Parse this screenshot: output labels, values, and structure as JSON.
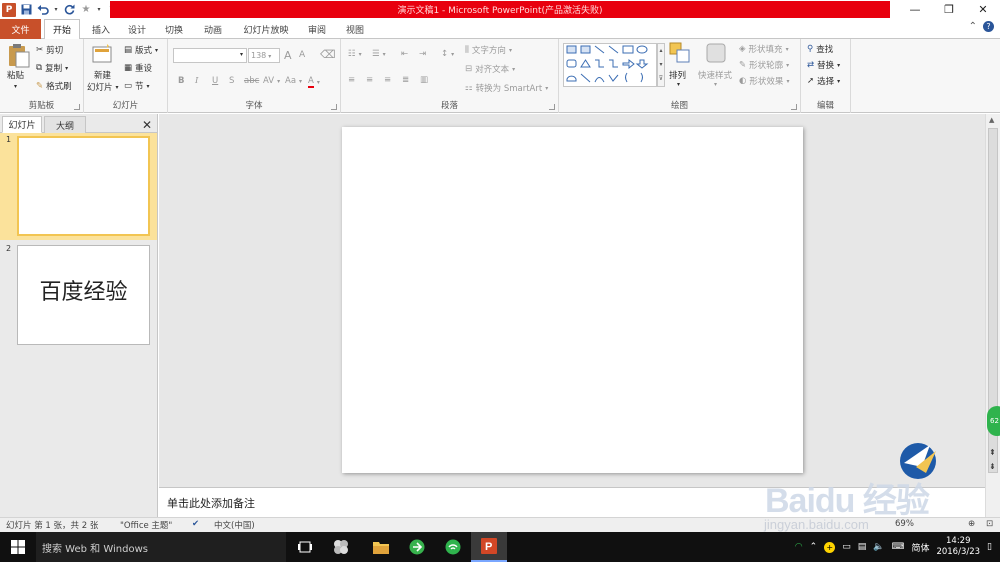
{
  "window": {
    "title": "演示文稿1 - Microsoft PowerPoint(产品激活失败)",
    "controls": {
      "minimize": "—",
      "restore": "❐",
      "close": "✕"
    }
  },
  "qat": {
    "logo": "P"
  },
  "tabs": [
    "文件",
    "开始",
    "插入",
    "设计",
    "切换",
    "动画",
    "幻灯片放映",
    "审阅",
    "视图"
  ],
  "ribbon": {
    "clipboard": {
      "paste": "粘贴",
      "cut": "剪切",
      "copy": "复制",
      "format_painter": "格式刷",
      "label": "剪贴板"
    },
    "slides": {
      "new_slide_1": "新建",
      "new_slide_2": "幻灯片",
      "layout": "版式",
      "reset": "重设",
      "section": "节",
      "label": "幻灯片"
    },
    "font": {
      "size": "138",
      "bold": "B",
      "italic": "I",
      "underline": "U",
      "strike": "S",
      "shadow": "abc",
      "spacing": "AV",
      "case": "Aa",
      "color": "A",
      "grow": "A",
      "shrink": "A",
      "label": "字体"
    },
    "paragraph": {
      "text_direction": "文字方向",
      "align_text": "对齐文本",
      "smartart": "转换为 SmartArt",
      "label": "段落"
    },
    "drawing": {
      "arrange": "排列",
      "quick_styles": "快速样式",
      "shape_fill": "形状填充",
      "shape_outline": "形状轮廓",
      "shape_effects": "形状效果",
      "label": "绘图"
    },
    "editing": {
      "find": "查找",
      "replace": "替换",
      "select": "选择",
      "label": "编辑"
    }
  },
  "left_panel": {
    "tab_slides": "幻灯片",
    "tab_outline": "大纲",
    "close": "✕",
    "slides": [
      {
        "number": "1",
        "text": ""
      },
      {
        "number": "2",
        "text": "百度经验"
      }
    ]
  },
  "notes": {
    "placeholder": "单击此处添加备注"
  },
  "status": {
    "slide_info": "幻灯片 第 1 张，共 2 张",
    "theme": "\"Office 主题\"",
    "language": "中文(中国)",
    "zoom": "69%"
  },
  "side_badge": "62",
  "watermark": {
    "logo": "Baidu 经验",
    "url": "jingyan.baidu.com"
  },
  "taskbar": {
    "search_placeholder": "搜索 Web 和 Windows",
    "ime": "简体",
    "time": "14:29",
    "date": "2016/3/23"
  },
  "colors": {
    "file_tab": "#c8502a",
    "title_bar": "#e8000e",
    "thumb_selected": "#f2c552"
  }
}
